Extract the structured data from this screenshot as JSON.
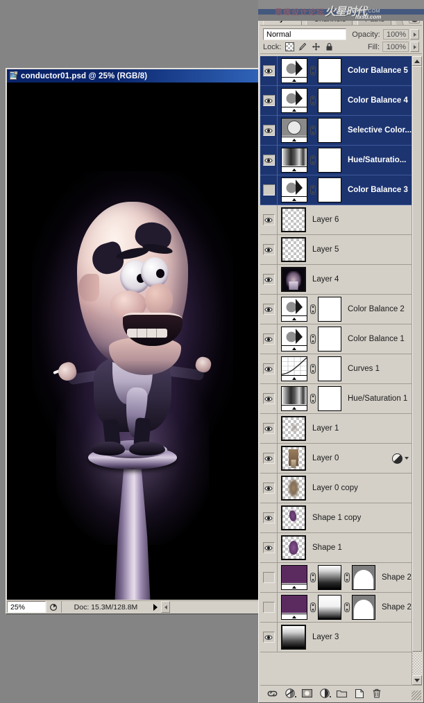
{
  "watermark": {
    "cn_text": "思缘设计论坛",
    "logo": "火星时代",
    "url": "WWW.HXSD.COM",
    "url2": "hxsd.com"
  },
  "document": {
    "title": "conductor01.psd @ 25% (RGB/8)",
    "icon": "photoshop-document-icon",
    "status": {
      "zoom": "25%",
      "zoom_placeholder": "25%",
      "doc_info": "Doc: 15.3M/128.8M",
      "preview_icon": "preview-options-icon",
      "play_icon": "play-arrow-icon",
      "resize_icon": "resize-grip-icon"
    }
  },
  "panel": {
    "tabs": [
      {
        "label": "Layers",
        "active": true
      },
      {
        "label": "Channels",
        "active": false
      },
      {
        "label": "Paths",
        "active": false
      }
    ],
    "menu_icon": "panel-menu-icon",
    "blend_mode": "Normal",
    "blend_mode_caret": "chevron-down-icon",
    "opacity_label": "Opacity:",
    "opacity_value": "100%",
    "opacity_spinner_icon": "chevron-right-icon",
    "lock_label": "Lock:",
    "lock_icons": [
      "lock-transparent-pixels-icon",
      "lock-image-pixels-icon",
      "lock-position-icon",
      "lock-all-icon"
    ],
    "fill_label": "Fill:",
    "fill_value": "100%",
    "fill_spinner_icon": "chevron-right-icon",
    "scrollbar": {
      "up_icon": "scroll-up-arrow-icon",
      "down_icon": "scroll-down-arrow-icon"
    },
    "footer_buttons": [
      {
        "name": "link-layers-button",
        "icon": "chain-link-icon"
      },
      {
        "name": "add-layer-style-button",
        "icon": "fx-circle-icon"
      },
      {
        "name": "add-layer-mask-button",
        "icon": "mask-circle-icon"
      },
      {
        "name": "new-adjustment-layer-button",
        "icon": "half-filled-circle-icon"
      },
      {
        "name": "new-group-button",
        "icon": "folder-icon"
      },
      {
        "name": "new-layer-button",
        "icon": "new-page-icon"
      },
      {
        "name": "delete-layer-button",
        "icon": "trash-can-icon"
      }
    ]
  },
  "layers": [
    {
      "name": "Color Balance 5",
      "visible": true,
      "selected": true,
      "type": "adjustment",
      "adj": "color-balance",
      "mask": true
    },
    {
      "name": "Color Balance 4",
      "visible": true,
      "selected": true,
      "type": "adjustment",
      "adj": "color-balance",
      "mask": true
    },
    {
      "name": "Selective Color...",
      "visible": true,
      "selected": true,
      "type": "adjustment",
      "adj": "selective-color",
      "mask": true
    },
    {
      "name": "Hue/Saturatio...",
      "visible": true,
      "selected": true,
      "type": "adjustment",
      "adj": "hue-saturation",
      "mask": true
    },
    {
      "name": "Color Balance 3",
      "visible": false,
      "selected": true,
      "type": "adjustment",
      "adj": "color-balance",
      "mask": true
    },
    {
      "name": "Layer 6",
      "visible": true,
      "selected": false,
      "type": "pixel",
      "thumb": "empty"
    },
    {
      "name": "Layer 5",
      "visible": true,
      "selected": false,
      "type": "pixel",
      "thumb": "empty"
    },
    {
      "name": "Layer 4",
      "visible": true,
      "selected": false,
      "type": "pixel",
      "thumb": "artwork"
    },
    {
      "name": "Color Balance 2",
      "visible": true,
      "selected": false,
      "type": "adjustment",
      "adj": "color-balance",
      "mask": true
    },
    {
      "name": "Color Balance 1",
      "visible": true,
      "selected": false,
      "type": "adjustment",
      "adj": "color-balance",
      "mask": true
    },
    {
      "name": "Curves 1",
      "visible": true,
      "selected": false,
      "type": "adjustment",
      "adj": "curves",
      "mask": true
    },
    {
      "name": "Hue/Saturation 1",
      "visible": true,
      "selected": false,
      "type": "adjustment",
      "adj": "hue-saturation",
      "mask": true
    },
    {
      "name": "Layer 1",
      "visible": true,
      "selected": false,
      "type": "pixel",
      "thumb": "faint"
    },
    {
      "name": "Layer 0",
      "visible": true,
      "selected": false,
      "type": "pixel",
      "thumb": "figure",
      "fx": true,
      "fx_icon": "layer-effects-icon",
      "fx_caret": "chevron-down-icon"
    },
    {
      "name": "Layer 0 copy",
      "visible": true,
      "selected": false,
      "type": "pixel",
      "thumb": "blur"
    },
    {
      "name": "Shape 1 copy",
      "visible": true,
      "selected": false,
      "type": "pixel",
      "thumb": "shape-purple"
    },
    {
      "name": "Shape 1",
      "visible": true,
      "selected": false,
      "type": "pixel",
      "thumb": "shape-purple2"
    },
    {
      "name": "Shape 2...",
      "visible": false,
      "selected": false,
      "type": "shape",
      "fill": "#5b2b60",
      "mask": "gradient-black-top",
      "vector": "dome"
    },
    {
      "name": "Shape 2",
      "visible": false,
      "selected": false,
      "type": "shape",
      "fill": "#5b2b60",
      "mask": "gradient-white-top",
      "vector": "dome"
    },
    {
      "name": "Layer 3",
      "visible": true,
      "selected": false,
      "type": "pixel",
      "thumb": "gradient"
    }
  ]
}
